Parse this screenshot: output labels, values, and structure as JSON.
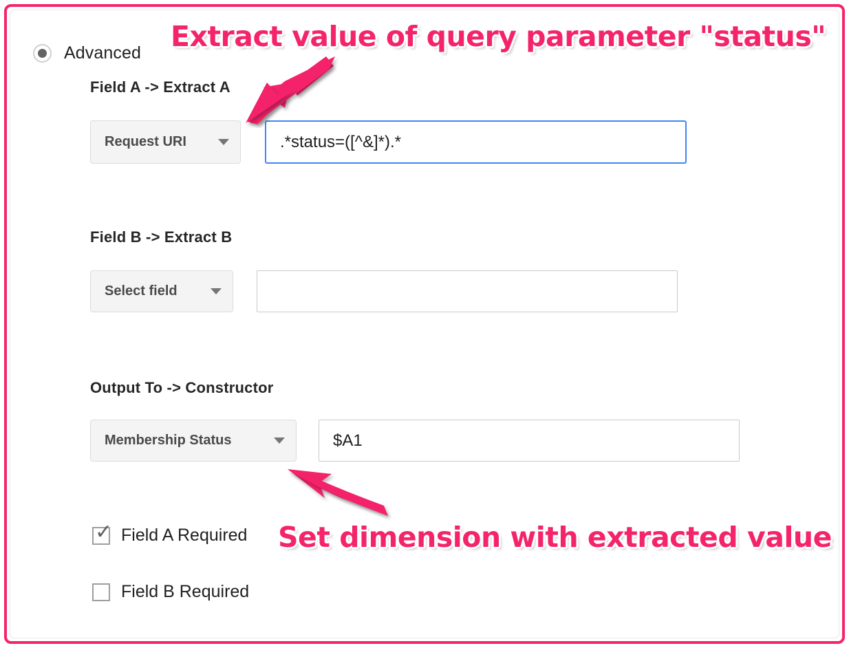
{
  "form": {
    "mode": {
      "label": "Advanced",
      "selected": true,
      "radio_icon": "radio-selected-icon"
    },
    "sections": {
      "field_a": {
        "label": "Field A -> Extract A",
        "dropdown": {
          "value": "Request URI",
          "caret_icon": "chevron-down-icon"
        },
        "input": {
          "value": ".*status=([^&]*).*",
          "placeholder": "",
          "focused": true,
          "focus_color": "#4285F4"
        }
      },
      "field_b": {
        "label": "Field B -> Extract B",
        "dropdown": {
          "value": "Select field",
          "caret_icon": "chevron-down-icon"
        },
        "input": {
          "value": "",
          "placeholder": "",
          "focused": false
        }
      },
      "output_to": {
        "label": "Output To -> Constructor",
        "dropdown": {
          "value": "Membership Status",
          "caret_icon": "chevron-down-icon"
        },
        "input": {
          "value": "$A1",
          "placeholder": "",
          "focused": false
        }
      }
    },
    "checkboxes": [
      {
        "label": "Field A Required",
        "checked": true,
        "tick_icon": "check-icon"
      },
      {
        "label": "Field B Required",
        "checked": false,
        "tick_icon": "check-icon"
      }
    ]
  },
  "annotations": {
    "color": "#F4246B",
    "outline_color": "#FFFFFF",
    "top": {
      "text": "Extract value of query parameter \"status\"",
      "arrow_icon": "arrow-down-left-icon"
    },
    "bottom": {
      "text": "Set dimension with extracted value",
      "arrow_icon": "arrow-up-left-icon"
    },
    "frame": {
      "color": "#F4246B"
    }
  }
}
